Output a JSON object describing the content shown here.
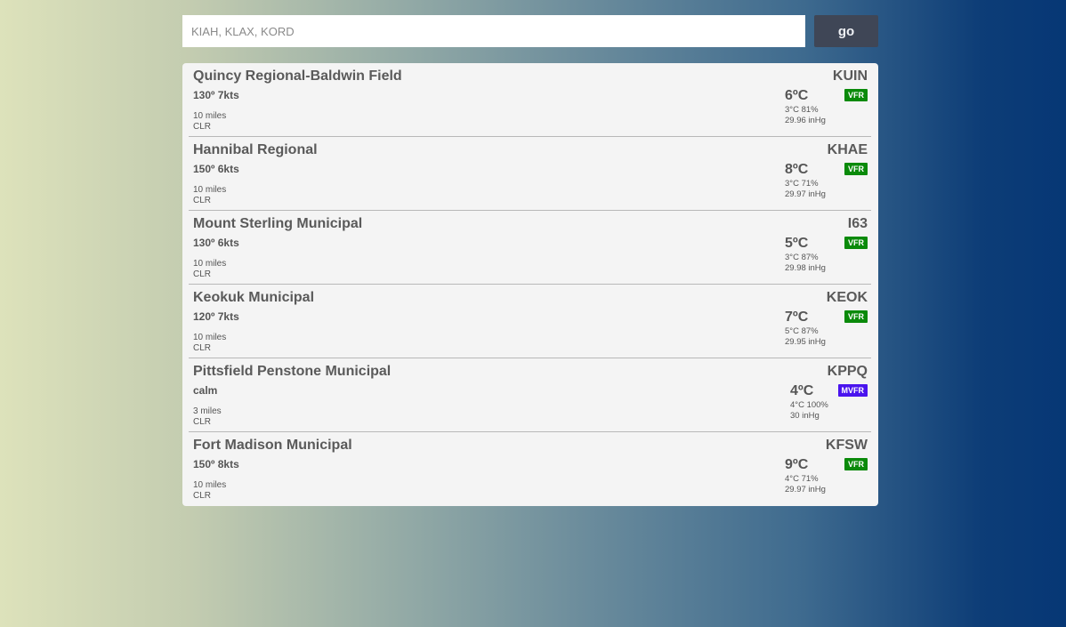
{
  "search": {
    "placeholder": "KIAH, KLAX, KORD",
    "value": "",
    "button_label": "go"
  },
  "colors": {
    "vfr": "#0a8a0a",
    "mvfr": "#4a14ee",
    "button": "#3f4656"
  },
  "stations": [
    {
      "name": "Quincy Regional-Baldwin Field",
      "id": "KUIN",
      "wind": "130º 7kts",
      "visibility": "10 miles",
      "sky": "CLR",
      "temp": "6ºC",
      "dew_humidity": "3°C 81%",
      "altimeter": "29.96 inHg",
      "category": "VFR"
    },
    {
      "name": "Hannibal Regional",
      "id": "KHAE",
      "wind": "150º 6kts",
      "visibility": "10 miles",
      "sky": "CLR",
      "temp": "8ºC",
      "dew_humidity": "3°C 71%",
      "altimeter": "29.97 inHg",
      "category": "VFR"
    },
    {
      "name": "Mount Sterling Municipal",
      "id": "I63",
      "wind": "130º 6kts",
      "visibility": "10 miles",
      "sky": "CLR",
      "temp": "5ºC",
      "dew_humidity": "3°C 87%",
      "altimeter": "29.98 inHg",
      "category": "VFR"
    },
    {
      "name": "Keokuk Municipal",
      "id": "KEOK",
      "wind": "120º 7kts",
      "visibility": "10 miles",
      "sky": "CLR",
      "temp": "7ºC",
      "dew_humidity": "5°C 87%",
      "altimeter": "29.95 inHg",
      "category": "VFR"
    },
    {
      "name": "Pittsfield Penstone Municipal",
      "id": "KPPQ",
      "wind": "calm",
      "visibility": "3 miles",
      "sky": "CLR",
      "temp": "4ºC",
      "dew_humidity": "4°C 100%",
      "altimeter": "30 inHg",
      "category": "MVFR"
    },
    {
      "name": "Fort Madison Municipal",
      "id": "KFSW",
      "wind": "150º 8kts",
      "visibility": "10 miles",
      "sky": "CLR",
      "temp": "9ºC",
      "dew_humidity": "4°C 71%",
      "altimeter": "29.97 inHg",
      "category": "VFR"
    }
  ]
}
